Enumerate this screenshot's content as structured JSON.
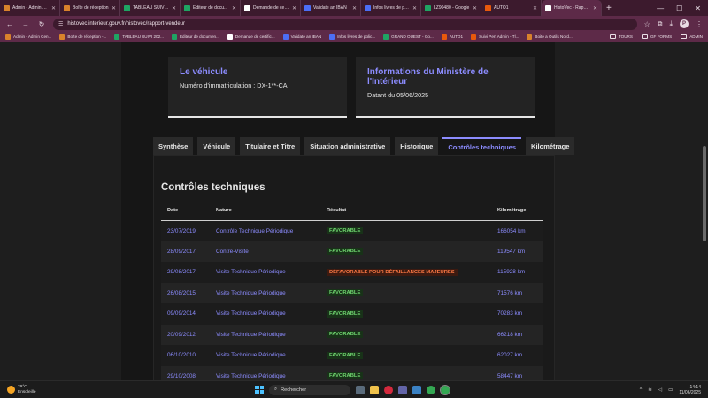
{
  "browser": {
    "tabs": [
      {
        "label": "Admin - Admin C...",
        "color": "#d9822b"
      },
      {
        "label": "Boîte de réception",
        "color": "#d9822b"
      },
      {
        "label": "TABLEAU SUIVI 2...",
        "color": "#1fa463"
      },
      {
        "label": "Editeur de docu...",
        "color": "#1fa463"
      },
      {
        "label": "Demande de certi...",
        "color": "#ffffff"
      },
      {
        "label": "Validate an IBAN",
        "color": "#4c6ef5"
      },
      {
        "label": "Infos livres de po...",
        "color": "#4c6ef5"
      },
      {
        "label": "LZ90480 - Google",
        "color": "#1fa463"
      },
      {
        "label": "AUTO1",
        "color": "#e8590c"
      },
      {
        "label": "HistoVec - Rappo...",
        "color": "#ffffff"
      }
    ],
    "url": "histovec.interieur.gouv.fr/histovec/rapport-vendeur",
    "avatar_initial": "P",
    "bookmarks": [
      {
        "label": "Admin - Admin Cen...",
        "color": "#d9822b"
      },
      {
        "label": "Boîte de réception -...",
        "color": "#d9822b"
      },
      {
        "label": "TABLEAU SUIVI 202...",
        "color": "#1fa463"
      },
      {
        "label": "Editeur de documen...",
        "color": "#1fa463"
      },
      {
        "label": "Demande de certific...",
        "color": "#ffffff"
      },
      {
        "label": "Validate an IBAN",
        "color": "#4c6ef5"
      },
      {
        "label": "Infos livres de polic...",
        "color": "#4c6ef5"
      },
      {
        "label": "GRAND OUEST - Go...",
        "color": "#1fa463"
      },
      {
        "label": "AUTO1",
        "color": "#e8590c"
      },
      {
        "label": "Suivi Perf Admin - Tl...",
        "color": "#e8590c"
      },
      {
        "label": "Boite a Outils Nord...",
        "color": "#d9822b"
      }
    ],
    "bookmark_folders": [
      "TOURS",
      "GF FORMS",
      "ADMIN"
    ]
  },
  "vehicle_card": {
    "title": "Le véhicule",
    "text": "Numéro d'immatriculation : DX-1**-CA"
  },
  "ministry_card": {
    "title": "Informations du Ministère de l'Intérieur",
    "text": "Datant du 05/06/2025"
  },
  "page_tabs": [
    "Synthèse",
    "Véhicule",
    "Titulaire et Titre",
    "Situation administrative",
    "Historique",
    "Contrôles techniques",
    "Kilométrage"
  ],
  "active_tab": "Contrôles techniques",
  "section_title": "Contrôles techniques",
  "table": {
    "headers": [
      "Date",
      "Nature",
      "Résultat",
      "Kilométrage"
    ],
    "rows": [
      {
        "date": "23/07/2019",
        "nature": "Contrôle Technique Périodique",
        "result": "FAVORABLE",
        "status": "ok",
        "km": "166054 km"
      },
      {
        "date": "28/09/2017",
        "nature": "Contre-Visite",
        "result": "FAVORABLE",
        "status": "ok",
        "km": "119547 km"
      },
      {
        "date": "29/08/2017",
        "nature": "Visite Technique Périodique",
        "result": "DÉFAVORABLE POUR DÉFAILLANCES MAJEURES",
        "status": "ko",
        "km": "115928 km"
      },
      {
        "date": "26/08/2015",
        "nature": "Visite Technique Périodique",
        "result": "FAVORABLE",
        "status": "ok",
        "km": "71576 km"
      },
      {
        "date": "09/09/2014",
        "nature": "Visite Technique Périodique",
        "result": "FAVORABLE",
        "status": "ok",
        "km": "70283 km"
      },
      {
        "date": "20/09/2012",
        "nature": "Visite Technique Périodique",
        "result": "FAVORABLE",
        "status": "ok",
        "km": "66218 km"
      },
      {
        "date": "06/10/2010",
        "nature": "Visite Technique Périodique",
        "result": "FAVORABLE",
        "status": "ok",
        "km": "62027 km"
      },
      {
        "date": "29/10/2008",
        "nature": "Visite Technique Périodique",
        "result": "FAVORABLE",
        "status": "ok",
        "km": "58447 km"
      }
    ]
  },
  "taskbar": {
    "temperature": "29°C",
    "weather": "Ensoleillé",
    "search_placeholder": "Rechercher",
    "time": "14:14",
    "date": "11/06/2025"
  }
}
